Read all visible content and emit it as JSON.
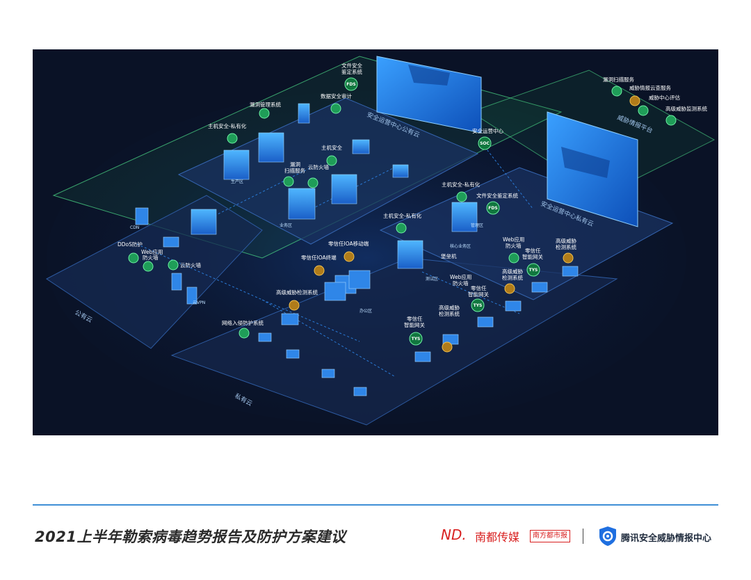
{
  "footer": {
    "title": "2021上半年勒索病毒趋势报告及防护方案建议",
    "nd_logo": "ND.",
    "nd_name": "南都传媒",
    "nd_paper": "南方都市报",
    "tencent_name": "腾讯安全威胁情报中心"
  },
  "colors": {
    "bg": "#0a1226",
    "accent": "#1f8bff",
    "green": "#3ad36b",
    "gold": "#f2c14e",
    "footer_rule": "#3f8fd6"
  },
  "zones": {
    "public_cloud": "公有云",
    "private_cloud": "私有云",
    "ops_public": "安全运营中心公有云",
    "ops_private": "安全运营中心私有云",
    "threat_platform": "威胁情报平台",
    "office": "办公区",
    "prod_zone": "生产区",
    "biz_zone": "业务区",
    "core_zone": "核心业务区",
    "test_zone": "测试区",
    "mgmt_zone": "管理区"
  },
  "labels": {
    "host_sec_private1": "主机安全-私有化",
    "vuln_mgmt": "漏洞管理系统",
    "file_sec1": "文件安全",
    "file_sec1b": "鉴定系统",
    "fds1": "FDS",
    "data_audit": "数据安全审计",
    "host_sec": "主机安全",
    "vuln_scan1": "漏洞",
    "vuln_scan2": "扫描服务",
    "cloud_fw1": "云防火墙",
    "soc_center": "安全运营中心",
    "soc": "SOC",
    "host_sec_private2": "主机安全-私有化",
    "file_sec2": "文件安全鉴定系统",
    "fds2": "FDS",
    "host_sec_private3": "主机安全-私有化",
    "ddos": "DDoS防护",
    "waf1a": "Web应用",
    "waf1b": "防火墙",
    "cloud_fw2": "云防火墙",
    "zt_ioa": "零信任IOA移动端",
    "zt_terminal": "零信任IOA终端",
    "hids1": "高级威胁检测系统",
    "bastion": "堡垒机",
    "waf2a": "Web应用",
    "waf2b": "防火墙",
    "zt_gw1a": "零信任",
    "zt_gw1b": "智能网关",
    "tys1": "TYS",
    "adv_threat1a": "高级威胁",
    "adv_threat1b": "检测系统",
    "waf3a": "Web应用",
    "waf3b": "防火墙",
    "zt_gw2a": "零信任",
    "zt_gw2b": "智能网关",
    "tys2": "TYS",
    "adv_threat2a": "高级威胁",
    "adv_threat2b": "检测系统",
    "adv_threat3a": "高级威胁",
    "adv_threat3b": "检测系统",
    "zt_gw3a": "零信任",
    "zt_gw3b": "智能网关",
    "tys3": "TYS",
    "nids": "网络入侵防护系统",
    "threat_svc1": "漏洞扫描服务",
    "threat_svc2": "威胁情报云查服务",
    "threat_svc3": "威胁中心评估",
    "threat_svc4": "高级威胁监测系统",
    "cdn": "CDN",
    "vpn": "云VPN"
  }
}
